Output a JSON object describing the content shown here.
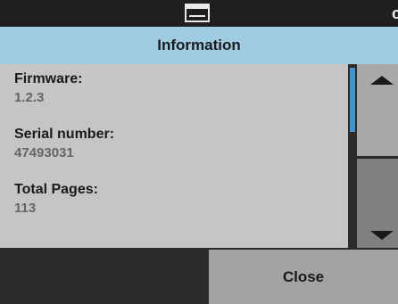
{
  "header": {
    "title": "Information"
  },
  "info_items": [
    {
      "label": "Firmware:",
      "value": "1.2.3"
    },
    {
      "label": "Serial number:",
      "value": "47493031"
    },
    {
      "label": "Total Pages:",
      "value": "113"
    }
  ],
  "footer": {
    "close_label": "Close"
  },
  "icons": {
    "top": "printer-icon",
    "scroll_up": "chevron-up-icon",
    "scroll_down": "chevron-down-icon"
  },
  "colors": {
    "header_bg": "#9fcbe3",
    "content_bg": "#c5c5c5",
    "scroll_accent": "#3d94cf",
    "button_bg": "#a3a3a3"
  }
}
